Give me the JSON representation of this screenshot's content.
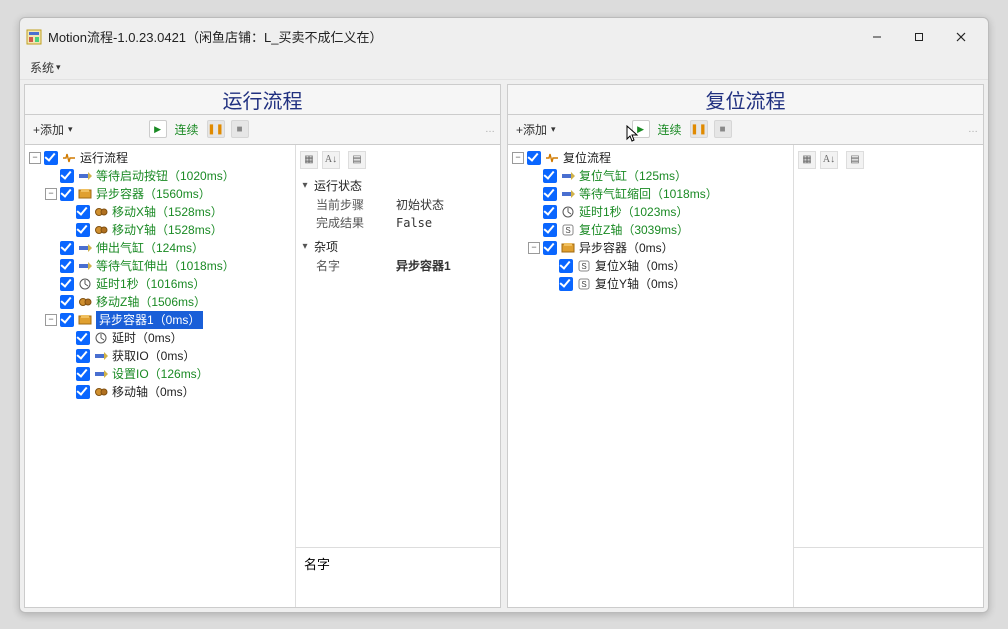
{
  "window": {
    "title": "Motion流程-1.0.23.0421（闲鱼店铺：L_买卖不成仁义在）"
  },
  "menubar": {
    "system": "系统"
  },
  "panels": {
    "left": {
      "title": "运行流程",
      "add": "+添加",
      "lianxu": "连续",
      "tree": {
        "root": "运行流程",
        "n_wait_btn": "等待启动按钮（1020ms）",
        "n_async": "异步容器（1560ms）",
        "n_movex": "移动X轴（1528ms）",
        "n_movey": "移动Y轴（1528ms）",
        "n_extend": "伸出气缸（124ms）",
        "n_wait_cyl": "等待气缸伸出（1018ms）",
        "n_delay1s": "延时1秒（1016ms）",
        "n_movez": "移动Z轴（1506ms）",
        "n_async1": "异步容器1（0ms）",
        "n_delay": "延时（0ms）",
        "n_getio": "获取IO（0ms）",
        "n_setio": "设置IO（126ms）",
        "n_moveaxis": "移动轴（0ms）"
      },
      "props": {
        "group_run": "运行状态",
        "cur_step_k": "当前步骤",
        "cur_step_v": "初始状态",
        "result_k": "完成结果",
        "result_v": "False",
        "group_misc": "杂项",
        "name_k": "名字",
        "name_v": "异步容器1",
        "footer": "名字"
      }
    },
    "right": {
      "title": "复位流程",
      "add": "+添加",
      "lianxu": "连续",
      "tree": {
        "root": "复位流程",
        "n_reset_cyl": "复位气缸（125ms）",
        "n_wait_back": "等待气缸缩回（1018ms）",
        "n_delay1s": "延时1秒（1023ms）",
        "n_resetz": "复位Z轴（3039ms）",
        "n_async": "异步容器（0ms）",
        "n_resetx": "复位X轴（0ms）",
        "n_resety": "复位Y轴（0ms）"
      }
    }
  }
}
